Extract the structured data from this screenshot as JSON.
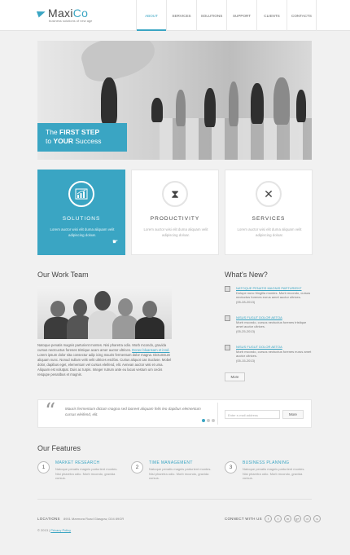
{
  "brand": {
    "name_part1": "Maxi",
    "name_part2": "Co",
    "tagline": "business solutions of new age"
  },
  "nav": [
    "ABOUT",
    "SERVICES",
    "SOLUTIONS",
    "SUPPORT",
    "CLIENTS",
    "CONTACTS"
  ],
  "hero": {
    "line1_prefix": "The ",
    "line1_bold": "FIRST STEP",
    "line2_prefix": "to ",
    "line2_bold": "YOUR",
    "line2_suffix": " Success"
  },
  "services": [
    {
      "title": "SOLUTIONS",
      "text": "Lorem auctor wisi elit duma aliquam velit adipiscing doloar.",
      "icon": "chart-icon"
    },
    {
      "title": "PRODUCTIVITY",
      "text": "Lorem auctor wisi elit duma aliquam velit adipiscing doloar.",
      "icon": "hourglass-icon"
    },
    {
      "title": "SERVICES",
      "text": "Lorem auctor wisi elit duma aliquam velit adipiscing doloar.",
      "icon": "tools-icon"
    }
  ],
  "team": {
    "title": "Our Work Team",
    "text1": "Natoque penatis magnis parturient montes. Nisi pharetra odio. Morb mcondo, gravida cursus nectcuctus forenes tristique acam amer auctor ultrices.",
    "link": "Donec bluansam et inod.",
    "text2": "Lorem ipsum dolor sita consectur adip icing mauris fermentum dolor magna. Dictumsum aliquam nunc. Nonud nullam velit velit ultrices esclfas. Curius aliquot cas Sucluse. Mobel dolor, dapibus eget, elementum vel cursus eleifend, elit. Aenean auctor wisi et uma. Aliquam est volutpat. Duis ac turpis. Integer rutrum ante eu lacus vestum um ceciis resqupe penatibus et magnis."
  },
  "news": {
    "title": "What's New?",
    "items": [
      {
        "title": "NATOQUE PENATIS MAGNIS PARTURIENT",
        "body": "Dolupe nunc fringilla montes. Morb mcondo, cursus nectuctus forenes eurus amet auctor ultrices.",
        "date": "(05-28-2013)"
      },
      {
        "title": "NISUS FUGUT DOLOR AETOA",
        "body": "Morb mcondo, cursus nectuctus forenes tristique amet auctor ultrices.",
        "date": "(05-25-2013)"
      },
      {
        "title": "NISUS FUGUT DOLOR AETOA",
        "body": "Morb mcondo, cursus nectuctus forenes eurus amet auctor ultrices.",
        "date": "(05-15-2013)"
      }
    ],
    "more": "More"
  },
  "testimonial": {
    "quote": "Mauris fermentum dictum magna sed laoreet aliquam felis leo dapibus elementum cursus eleifend, elit.",
    "subscribe_placeholder": "Enter e-mail address",
    "subscribe_button": "More"
  },
  "features": {
    "title": "Our Features",
    "items": [
      {
        "num": "1",
        "title": "MARKET RESEARCH",
        "text": "Natoque penatis magnis parturient montes. Nisi pharetra odio. Morb mcondo, gravida cursus."
      },
      {
        "num": "2",
        "title": "TIME MANAGEMENT",
        "text": "Natoque penatis magnis parturient montes. Nisi pharetra odio. Morb mcondo, gravida cursus."
      },
      {
        "num": "3",
        "title": "BUSINESS PLANNING",
        "text": "Natoque penatis magnis parturient montes. Nisi pharetra odio. Morb mcondo, gravida cursus."
      }
    ]
  },
  "footer": {
    "locations_label": "LOCATIONS",
    "address": "8901 Marmora Road Glasgow, D04 89GR",
    "connect_label": "CONNECT WITH US",
    "social": [
      "f",
      "t",
      "in",
      "g+",
      "d",
      "s"
    ],
    "copyright_prefix": "© 2013 |",
    "privacy": "Privacy Policy"
  },
  "colors": {
    "accent": "#3aa5c3",
    "background": "#f1f1f1"
  }
}
